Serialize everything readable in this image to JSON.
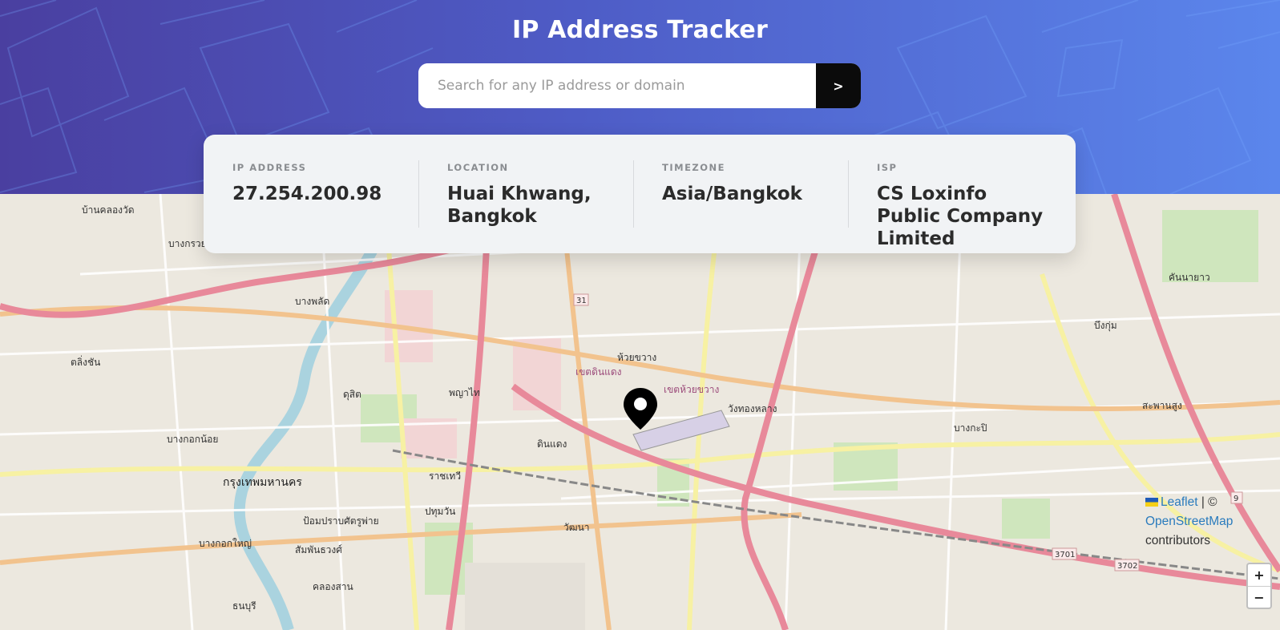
{
  "header": {
    "title": "IP Address Tracker",
    "search_placeholder": "Search for any IP address or domain",
    "search_value": "",
    "submit_label": ">"
  },
  "info": {
    "ip_label": "IP ADDRESS",
    "ip_value": "27.254.200.98",
    "location_label": "LOCATION",
    "location_value": "Huai Khwang, Bangkok",
    "timezone_label": "TIMEZONE",
    "timezone_value": "Asia/Bangkok",
    "isp_label": "ISP",
    "isp_value": "CS Loxinfo Public Company Limited"
  },
  "map": {
    "labels": [
      "ห้วยขวาง",
      "วังทองหลาง",
      "ดินแดง",
      "พญาไท",
      "ราชเทวี",
      "ปทุมวัน",
      "วัฒนา",
      "บางกะปิ",
      "สะพานสูง",
      "บึงกุ่ม",
      "คันนายาว",
      "ดุสิต",
      "บางพลัด",
      "ตลิ่งชัน",
      "บางกอกน้อย",
      "กรุงเทพมหานคร",
      "ป้อมปราบศัตรูพ่าย",
      "สัมพันธวงศ์",
      "บางกอกใหญ่",
      "คลองสาน",
      "ธนบุรี",
      "บ้านคลองวัด",
      "บางกรวย",
      "เขตห้วยขวาง",
      "เขตดินแดง"
    ],
    "route_badges": [
      "31",
      "3701",
      "3702",
      "9"
    ],
    "zoom_in": "+",
    "zoom_out": "−"
  },
  "attribution": {
    "leaflet": "Leaflet",
    "separator": " | © ",
    "osm": "OpenStreetMap",
    "contributors": "contributors"
  },
  "colors": {
    "header_gradient_start": "#4a3fa0",
    "header_gradient_end": "#5b86ec",
    "button_bg": "#0b0b0b",
    "card_bg": "#f1f3f5"
  }
}
